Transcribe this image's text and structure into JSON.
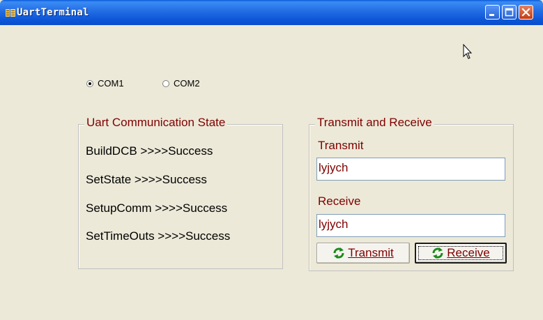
{
  "window": {
    "title": "UartTerminal"
  },
  "ports": [
    {
      "label": "COM1",
      "selected": true
    },
    {
      "label": "COM2",
      "selected": false
    }
  ],
  "state_group": {
    "title": "Uart Communication State",
    "lines": [
      "BuildDCB >>>>Success",
      "SetState >>>>Success",
      "SetupComm >>>>Success",
      "SetTimeOuts >>>>Success"
    ]
  },
  "tr_group": {
    "title": "Transmit and Receive",
    "transmit_label": "Transmit",
    "transmit_value": "lyjych",
    "receive_label": "Receive",
    "receive_value": "lyjych",
    "transmit_button": "Transmit",
    "receive_button": "Receive"
  },
  "colors": {
    "label": "#800000",
    "window_bg": "#ece9d8",
    "titlebar": "#0a55d6"
  },
  "icons": {
    "app": "app-icon",
    "minimize": "minimize-icon",
    "maximize": "maximize-icon",
    "close": "close-icon",
    "refresh": "refresh-icon",
    "cursor": "mouse-cursor-icon"
  }
}
